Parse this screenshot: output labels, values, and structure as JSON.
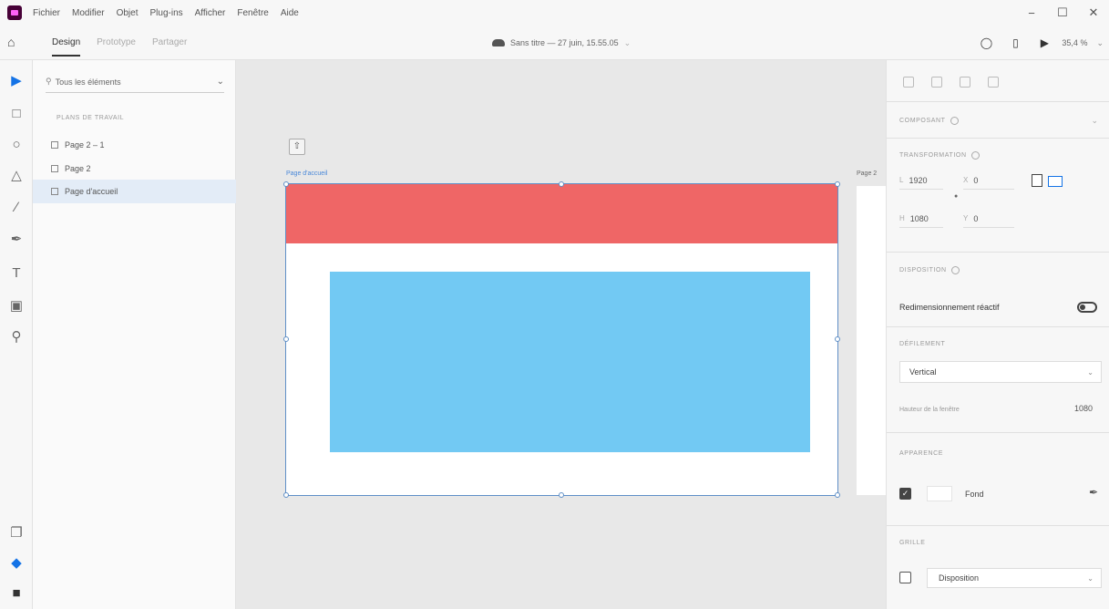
{
  "menubar": {
    "items": [
      "Fichier",
      "Modifier",
      "Objet",
      "Plug-ins",
      "Afficher",
      "Fenêtre",
      "Aide"
    ],
    "controls": [
      "−",
      "☐",
      "✕"
    ]
  },
  "topbar": {
    "tabs": [
      "Design",
      "Prototype",
      "Partager"
    ],
    "doc_title": "Sans titre — 27 juin, 15.55.05",
    "zoom": "35,4 %"
  },
  "layers": {
    "filter": "Tous les éléments",
    "section": "PLANS DE TRAVAIL",
    "artboards": [
      "Page 2 – 1",
      "Page 2",
      "Page d'accueil"
    ]
  },
  "canvas": {
    "artboard_label": "Page d'accueil",
    "second_label": "Page 2",
    "colors": {
      "header": "#ef6666",
      "content": "#72c9f3"
    }
  },
  "props": {
    "component": "COMPOSANT",
    "transform": "TRANSFORMATION",
    "w_label": "L",
    "w_value": "1920",
    "h_label": "H",
    "h_value": "1080",
    "x_label": "X",
    "x_value": "0",
    "y_label": "Y",
    "y_value": "0",
    "layout": "DISPOSITION",
    "responsive": "Redimensionnement réactif",
    "scroll": "DÉFILEMENT",
    "scroll_value": "Vertical",
    "viewport_label": "Hauteur de la fenêtre",
    "viewport_value": "1080",
    "appearance": "APPARENCE",
    "fill_label": "Fond",
    "grid": "GRILLE",
    "grid_value": "Disposition"
  }
}
